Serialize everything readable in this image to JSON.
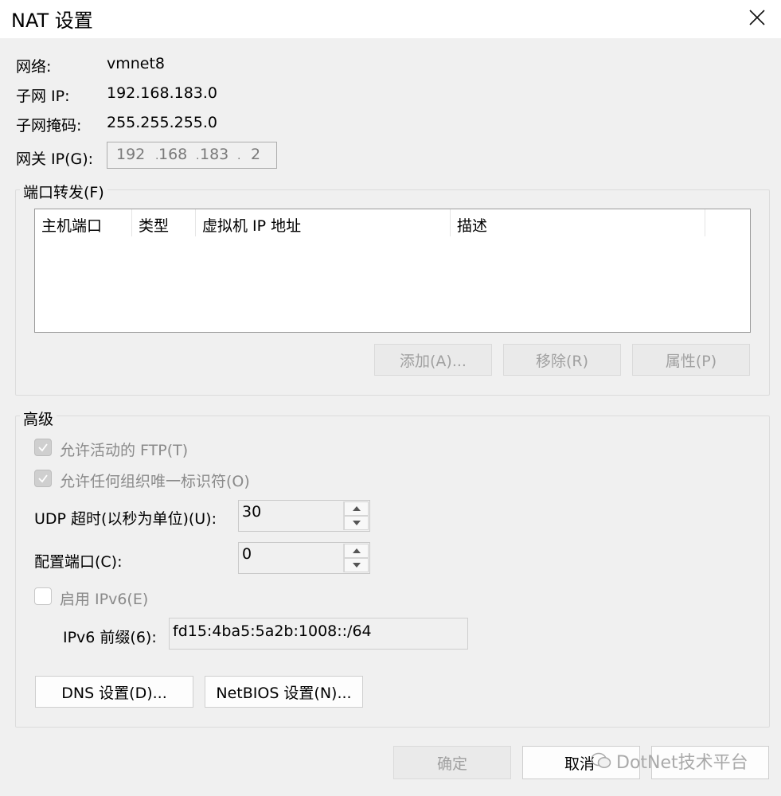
{
  "window": {
    "title": "NAT 设置",
    "close_icon": "×"
  },
  "info": {
    "network_label": "网络:",
    "network_value": "vmnet8",
    "subnet_ip_label": "子网 IP:",
    "subnet_ip_value": "192.168.183.0",
    "subnet_mask_label": "子网掩码:",
    "subnet_mask_value": "255.255.255.0",
    "gateway_label": "网关 IP(G):",
    "gateway_octets": [
      "192",
      "168",
      "183",
      "2"
    ]
  },
  "port_forwarding": {
    "group_title": "端口转发(F)",
    "columns": [
      "主机端口",
      "类型",
      "虚拟机 IP 地址",
      "描述"
    ],
    "rows": [],
    "add_label": "添加(A)...",
    "remove_label": "移除(R)",
    "properties_label": "属性(P)"
  },
  "advanced": {
    "group_title": "高级",
    "allow_ftp_label": "允许活动的 FTP(T)",
    "allow_ftp_checked": true,
    "allow_oui_label": "允许任何组织唯一标识符(O)",
    "allow_oui_checked": true,
    "udp_timeout_label": "UDP 超时(以秒为单位)(U):",
    "udp_timeout_value": "30",
    "config_port_label": "配置端口(C):",
    "config_port_value": "0",
    "enable_ipv6_label": "启用 IPv6(E)",
    "enable_ipv6_checked": false,
    "ipv6_prefix_label": "IPv6 前缀(6):",
    "ipv6_prefix_value": "fd15:4ba5:5a2b:1008::/64",
    "dns_label": "DNS 设置(D)...",
    "netbios_label": "NetBIOS 设置(N)..."
  },
  "footer": {
    "ok_label": "确定",
    "cancel_label": "取消",
    "watermark_text": "DotNet技术平台"
  },
  "colors": {
    "background": "#f0f0f0",
    "disabled_text": "#a0a0a0"
  }
}
